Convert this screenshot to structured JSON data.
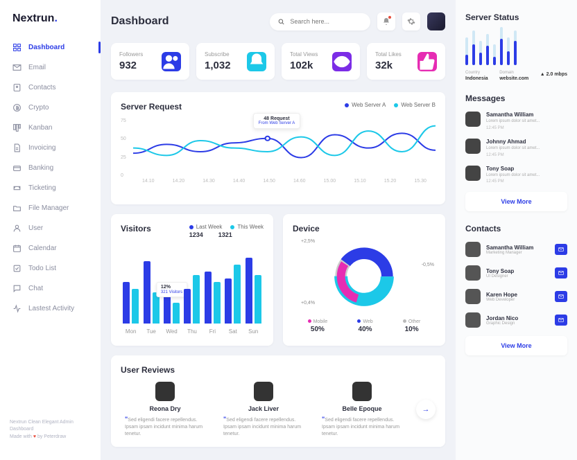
{
  "brand": {
    "name": "Nextrun",
    "suffix": "."
  },
  "nav": [
    {
      "label": "Dashboard",
      "icon": "dashboard",
      "active": true
    },
    {
      "label": "Email",
      "icon": "email"
    },
    {
      "label": "Contacts",
      "icon": "contacts"
    },
    {
      "label": "Crypto",
      "icon": "crypto"
    },
    {
      "label": "Kanban",
      "icon": "kanban"
    },
    {
      "label": "Invoicing",
      "icon": "invoicing"
    },
    {
      "label": "Banking",
      "icon": "banking"
    },
    {
      "label": "Ticketing",
      "icon": "ticketing"
    },
    {
      "label": "File Manager",
      "icon": "files"
    },
    {
      "label": "User",
      "icon": "user"
    },
    {
      "label": "Calendar",
      "icon": "calendar"
    },
    {
      "label": "Todo List",
      "icon": "todo"
    },
    {
      "label": "Chat",
      "icon": "chat"
    },
    {
      "label": "Lastest Activity",
      "icon": "activity"
    }
  ],
  "footer": {
    "line1": "Nextrun Clean Elegant Admin Dashboard",
    "line2_a": "Made with ",
    "line2_b": " by Peterdraw"
  },
  "header": {
    "title": "Dashboard",
    "search_placeholder": "Search here..."
  },
  "stats": [
    {
      "label": "Followers",
      "value": "932",
      "color": "bg-blue",
      "icon": "users"
    },
    {
      "label": "Subscribe",
      "value": "1,032",
      "color": "bg-cyan",
      "icon": "bell"
    },
    {
      "label": "Total Views",
      "value": "102k",
      "color": "bg-purple",
      "icon": "eye"
    },
    {
      "label": "Total Likes",
      "value": "32k",
      "color": "bg-pink",
      "icon": "thumb"
    }
  ],
  "server_request": {
    "title": "Server Request",
    "legend": [
      "Web Server A",
      "Web Server B"
    ],
    "tooltip": {
      "title": "48 Request",
      "sub": "From Web Server A"
    },
    "ylabels": [
      "75",
      "50",
      "25",
      "0"
    ],
    "xlabels": [
      "14.10",
      "14.20",
      "14.30",
      "14.40",
      "14.50",
      "14.60",
      "15.00",
      "15.10",
      "15.20",
      "15.30"
    ]
  },
  "visitors": {
    "title": "Visitors",
    "legend": [
      "Last Week",
      "This Week"
    ],
    "last": "1234",
    "this": "1321",
    "tooltip": {
      "pct": "12%",
      "sub": "321 Visitors"
    },
    "days": [
      "Mon",
      "Tue",
      "Wed",
      "Thu",
      "Fri",
      "Sat",
      "Sun"
    ]
  },
  "device": {
    "title": "Device",
    "ann": [
      "+2,5%",
      "-0,5%",
      "+0,4%"
    ],
    "items": [
      {
        "label": "Mobile",
        "pct": "50%",
        "cls": "lg-pk"
      },
      {
        "label": "Web",
        "pct": "40%",
        "cls": "lg-bl"
      },
      {
        "label": "Other",
        "pct": "10%",
        "cls": "lg-gr"
      }
    ]
  },
  "reviews": {
    "title": "User Reviews",
    "items": [
      {
        "name": "Belle Epoque",
        "text": "Sed eligendi facere repellendus. Ipsam ipsam incidunt minima harum tenetur."
      },
      {
        "name": "Jack Liver",
        "text": "Sed eligendi facere repellendus. Ipsam ipsam incidunt minima harum tenetur."
      },
      {
        "name": "Reona Dry",
        "text": "Sed eligendi facere repellendus. Ipsam ipsam incidunt minima harum tenetur."
      }
    ]
  },
  "server_status": {
    "title": "Server Status",
    "meta": [
      {
        "label": "Country",
        "value": "Indonesia"
      },
      {
        "label": "Domain",
        "value": "website.com"
      },
      {
        "label": "",
        "value": "2.0 mbps",
        "arrow": true
      }
    ]
  },
  "messages": {
    "title": "Messages",
    "items": [
      {
        "name": "Samantha William",
        "text": "Lorem ipsum dolor sit amet...",
        "time": "12:45 PM"
      },
      {
        "name": "Johnny Ahmad",
        "text": "Lorem ipsum dolor sit amet...",
        "time": "12:45 PM"
      },
      {
        "name": "Tony Soap",
        "text": "Lorem ipsum dolor sit amet...",
        "time": "12:45 PM"
      }
    ],
    "view_more": "View More"
  },
  "contacts": {
    "title": "Contacts",
    "items": [
      {
        "name": "Samantha William",
        "role": "Marketing Manager"
      },
      {
        "name": "Tony Soap",
        "role": "UI Designer"
      },
      {
        "name": "Karen Hope",
        "role": "Web Developer"
      },
      {
        "name": "Jordan Nico",
        "role": "Graphic Design"
      }
    ],
    "view_more": "View More"
  },
  "chart_data": {
    "server_request": {
      "type": "line",
      "x": [
        "14.10",
        "14.20",
        "14.30",
        "14.40",
        "14.50",
        "14.60",
        "15.00",
        "15.10",
        "15.20",
        "15.30"
      ],
      "series": [
        {
          "name": "Web Server A",
          "values": [
            28,
            40,
            30,
            42,
            48,
            22,
            53,
            35,
            55,
            32
          ]
        },
        {
          "name": "Web Server B",
          "values": [
            35,
            25,
            45,
            35,
            30,
            50,
            25,
            58,
            30,
            65
          ]
        }
      ],
      "ylim": [
        0,
        75
      ],
      "ylabel": "",
      "xlabel": "",
      "title": "Server Request"
    },
    "visitors": {
      "type": "bar",
      "categories": [
        "Mon",
        "Tue",
        "Wed",
        "Thu",
        "Fri",
        "Sat",
        "Sun"
      ],
      "series": [
        {
          "name": "Last Week",
          "values": [
            60,
            90,
            55,
            50,
            75,
            65,
            95
          ]
        },
        {
          "name": "This Week",
          "values": [
            50,
            45,
            30,
            70,
            60,
            85,
            70
          ]
        }
      ],
      "title": "Visitors",
      "ylim": [
        0,
        100
      ]
    },
    "device": {
      "type": "pie",
      "categories": [
        "Mobile",
        "Web",
        "Other"
      ],
      "values": [
        50,
        40,
        10
      ],
      "title": "Device"
    },
    "server_status_bars": {
      "type": "bar",
      "categories": [
        "1",
        "2",
        "3",
        "4",
        "5",
        "6",
        "7",
        "8"
      ],
      "series": [
        {
          "name": "bg",
          "values": [
            40,
            50,
            35,
            45,
            30,
            55,
            40,
            50
          ]
        },
        {
          "name": "fill",
          "values": [
            15,
            30,
            18,
            28,
            12,
            38,
            20,
            35
          ]
        }
      ]
    }
  }
}
